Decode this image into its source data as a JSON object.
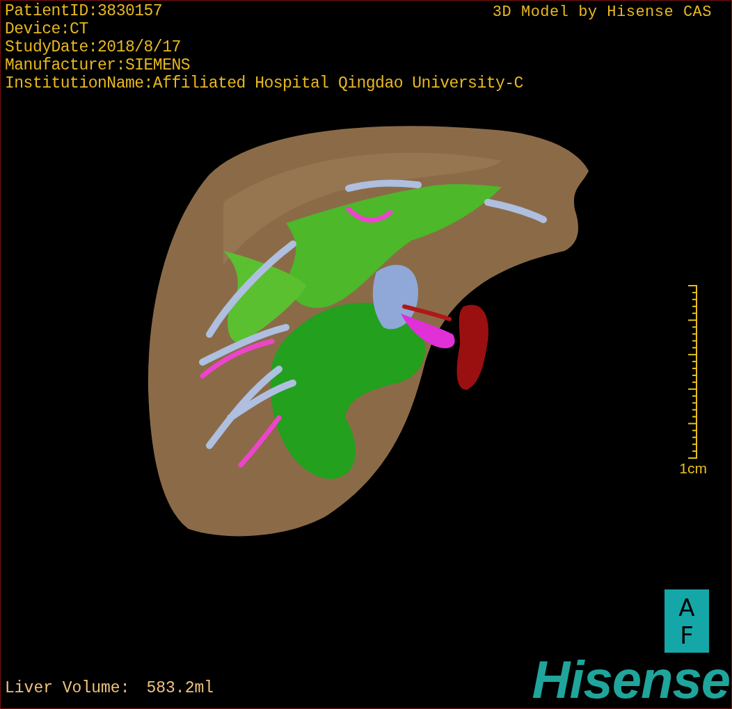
{
  "info_lines": [
    "PatientID:3830157",
    "Device:CT",
    "StudyDate:2018/8/17",
    "Manufacturer:SIEMENS",
    "InstitutionName:Affiliated Hospital Qingdao University-C"
  ],
  "credit": "3D Model by Hisense CAS",
  "scale_bar": {
    "label": "1cm"
  },
  "orientation_cube": {
    "top": "A",
    "bottom": "F"
  },
  "logo": "Hisense",
  "liver_volume": {
    "label": "Liver Volume:",
    "value": "583.2ml"
  }
}
